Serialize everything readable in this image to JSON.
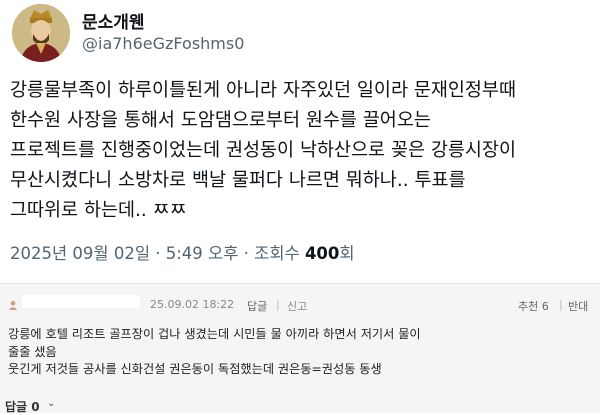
{
  "tweet": {
    "display_name": "문소개웬",
    "handle": "@ia7h6eGzFoshms0",
    "body_lines": [
      "강릉물부족이 하루이틀된게 아니라 자주있던 일이라 문재인정부때",
      "한수원 사장을 통해서 도암댐으로부터 원수를 끌어오는",
      "프로젝트를 진행중이었는데 권성동이 낙하산으로 꽂은 강릉시장이",
      "무산시켰다니 소방차로 백날 물퍼다 나르면 뭐하나.. 투표를",
      "그따위로 하는데.. ㅉㅉ"
    ],
    "timestamp": "2025년 09월 02일 · 5:49 오후 · 조회수",
    "views_count": "400",
    "views_unit": "회"
  },
  "comment": {
    "date": "25.09.02 18:22",
    "reply_label": "답글",
    "separator": "|",
    "report_label": "신고",
    "recommend_label": "추천 6",
    "oppose_label": "반대",
    "text_lines": [
      "강릉에 호텔 리조트 골프장이 겁나 생겼는데 시민들 물 아끼라 하면서 저기서 물이",
      "줄줄 샜음",
      "웃긴게 저것들 공사를 신화건설 권은동이 독점했는데 권은동=권성동 동생"
    ],
    "reply_count_label": "답글 0",
    "chevron": "⌄"
  },
  "icons": {
    "avatar": "avatar-portrait",
    "author": "user-icon",
    "chevron": "chevron-down-icon"
  }
}
